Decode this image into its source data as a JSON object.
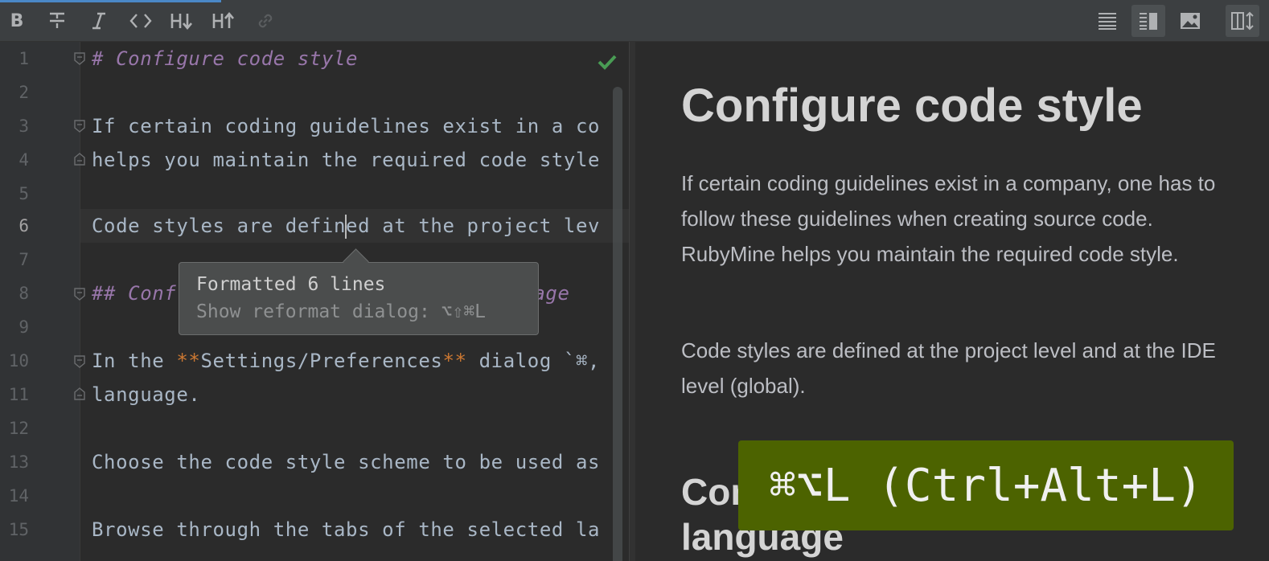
{
  "toolbar": {
    "buttons": [
      {
        "name": "bold",
        "glyph": "B"
      },
      {
        "name": "strikethrough",
        "glyph": "S"
      },
      {
        "name": "italic",
        "glyph": "I"
      },
      {
        "name": "code",
        "glyph": "<>"
      },
      {
        "name": "header-down",
        "glyph": "H↓"
      },
      {
        "name": "header-up",
        "glyph": "H↑"
      },
      {
        "name": "link",
        "glyph": "link"
      }
    ],
    "views": [
      "editor-only",
      "editor-and-preview",
      "preview-only",
      "sync-scroll"
    ],
    "active_view": "editor-and-preview"
  },
  "editor": {
    "line_numbers": [
      "1",
      "2",
      "3",
      "4",
      "5",
      "6",
      "7",
      "8",
      "9",
      "10",
      "11",
      "12",
      "13",
      "14",
      "15"
    ],
    "current_line": 6,
    "lines": {
      "l1": "# Configure code style",
      "l3": "If certain coding guidelines exist in a co",
      "l4": "helps you maintain the required code style",
      "l6a": "Code styles are defin",
      "l6b": "ed at the project lev",
      "l8a": "## Conf",
      "l8b": "age",
      "l10a": "In the ",
      "l10b": "**",
      "l10c": "Settings/Preferences",
      "l10d": "**",
      "l10e": " dialog `⌘,",
      "l11": "language.",
      "l13": "Choose the code style scheme to be used as",
      "l15": "Browse through the tabs of the selected la"
    },
    "status": "no-problems"
  },
  "tooltip": {
    "title": "Formatted 6 lines",
    "hint": "Show reformat dialog: ⌥⇧⌘L"
  },
  "preview": {
    "h1": "Configure code style",
    "p1": "If certain coding guidelines exist in a company, one has to follow these guidelines when creating source code. RubyMine helps you maintain the required code style.",
    "p2": "Code styles are defined at the project level and at the IDE level (global).",
    "h2": "Configure code style for a language"
  },
  "shortcut_overlay": "⌘⌥L (Ctrl+Alt+L)",
  "colors": {
    "accent": "#4a88c7",
    "heading": "#9876aa",
    "bold_marker": "#cc7832",
    "overlay": "#4c6300",
    "check": "#499c54"
  }
}
